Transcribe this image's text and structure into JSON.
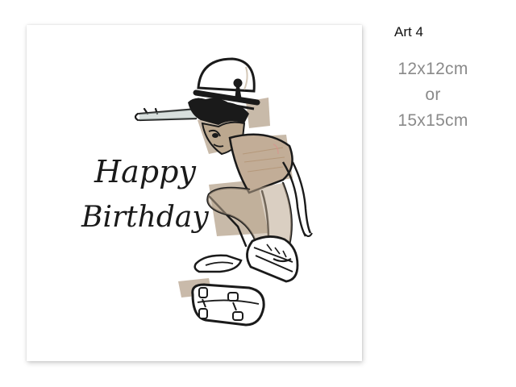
{
  "card": {
    "greeting_line_1": "Happy",
    "greeting_line_2": "Birthday",
    "illustration": "skateboarder-illustration"
  },
  "info": {
    "title": "Art 4",
    "sizes": [
      "12x12cm",
      "or",
      "15x15cm"
    ]
  },
  "colors": {
    "page_background": "#ffffff",
    "card_background": "#ffffff",
    "ink": "#1a1a1a",
    "tan_tone": "#b8a590",
    "size_text": "#8a8a8a"
  }
}
